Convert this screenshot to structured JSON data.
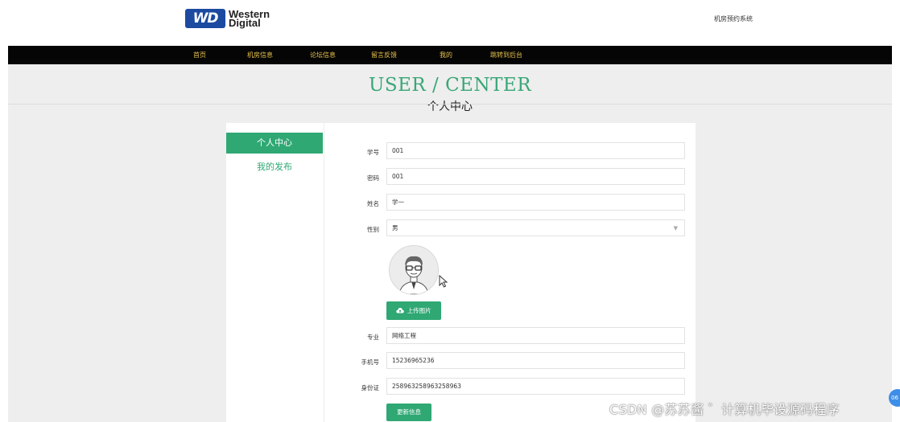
{
  "header": {
    "logo_badge": "WD",
    "logo_line1": "Western",
    "logo_line2": "Digital",
    "site_title": "机房预约系统"
  },
  "nav": {
    "items": [
      "首页",
      "机房信息",
      "论坛信息",
      "留言反馈",
      "我的",
      "跳转到后台"
    ]
  },
  "hero": {
    "title_en": "USER / CENTER",
    "title_cn": "个人中心"
  },
  "sidebar": {
    "items": [
      {
        "label": "个人中心",
        "active": true
      },
      {
        "label": "我的发布",
        "active": false
      }
    ]
  },
  "form": {
    "student_id": {
      "label": "学号",
      "value": "001"
    },
    "password": {
      "label": "密码",
      "value": "001"
    },
    "name": {
      "label": "姓名",
      "value": "学一"
    },
    "gender": {
      "label": "性别",
      "value": "男"
    },
    "upload_label": "上传图片",
    "major": {
      "label": "专业",
      "value": "网络工程"
    },
    "phone": {
      "label": "手机号",
      "value": "15236965236"
    },
    "id_card": {
      "label": "身份证",
      "value": "258963258963258963"
    },
    "submit_label": "更新信息"
  },
  "watermark": "CSDN @苏苏酱    ゛计算机毕设源码程序",
  "float_badge": "06",
  "colors": {
    "accent": "#2fa874",
    "nav_bg": "#050505",
    "nav_text": "#e8c34a",
    "page_bg": "#eeeeee"
  },
  "icons": [
    "wd-logo-icon",
    "select-chevron-icon",
    "avatar-man-icon",
    "mouse-cursor-icon",
    "cloud-upload-icon"
  ]
}
